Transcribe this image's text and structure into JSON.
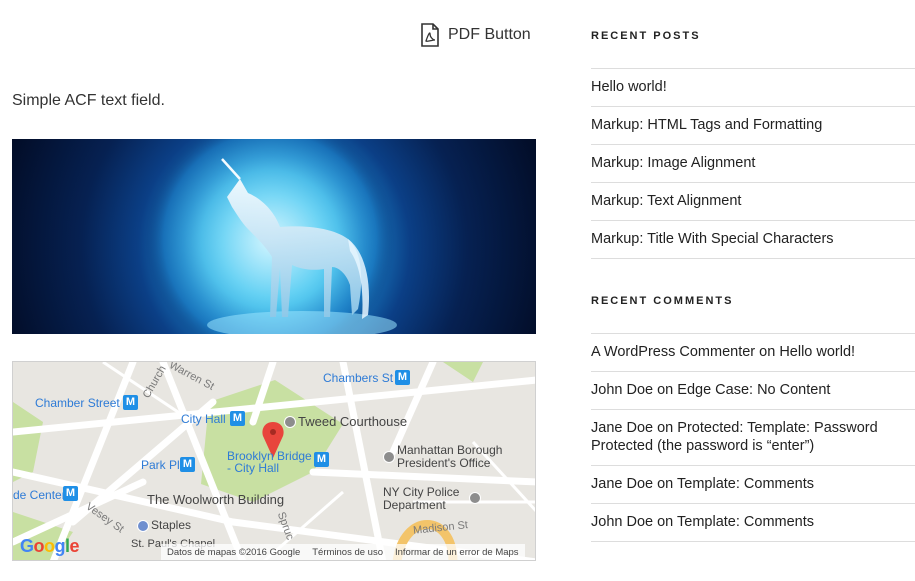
{
  "main": {
    "pdf_button_label": "PDF Button",
    "acf_text": "Simple ACF text field."
  },
  "map": {
    "labels": {
      "chambers_st": "Chambers St",
      "chamber_street": "Chamber Street",
      "city_hall_station": "City Hall",
      "tweed_courthouse": "Tweed Courthouse",
      "park_pl": "Park Pl",
      "brooklyn_bridge": "Brooklyn Bridge - City Hall",
      "manhattan_borough": "Manhattan Borough President's Office",
      "de_center": "de Center",
      "woolworth": "The Woolworth Building",
      "nypd": "NY City Police Department",
      "staples": "Staples",
      "madison_st": "Madison St",
      "st_pauls": "St. Paul's Chapel",
      "warren_st": "Warren St",
      "church_st": "Church",
      "vesey_st": "Vesey St",
      "spruce": "Spruc"
    },
    "metro_letter": "M",
    "footer": {
      "data": "Datos de mapas ©2016 Google",
      "terms": "Términos de uso",
      "report": "Informar de un error de Maps"
    },
    "logo_letters": [
      "G",
      "o",
      "o",
      "g",
      "l",
      "e"
    ]
  },
  "sidebar": {
    "recent_posts_title": "RECENT POSTS",
    "recent_posts": [
      "Hello world!",
      "Markup: HTML Tags and Formatting",
      "Markup: Image Alignment",
      "Markup: Text Alignment",
      "Markup: Title With Special Characters"
    ],
    "recent_comments_title": "RECENT COMMENTS",
    "on_word": "on",
    "recent_comments": [
      {
        "author": "A WordPress Commenter",
        "post": "Hello world!"
      },
      {
        "author": "John Doe",
        "post": "Edge Case: No Content"
      },
      {
        "author": "Jane Doe",
        "post": "Protected: Template: Password Protected (the password is “enter”)"
      },
      {
        "author": "Jane Doe",
        "post": "Template: Comments"
      },
      {
        "author": "John Doe",
        "post": "Template: Comments"
      }
    ]
  },
  "colors": {
    "link": "#222222",
    "metro_blue": "#1f8fe6",
    "map_label_blue": "#2e7bd6",
    "park_green": "#c8e0a2",
    "pin_red": "#e8453c"
  }
}
